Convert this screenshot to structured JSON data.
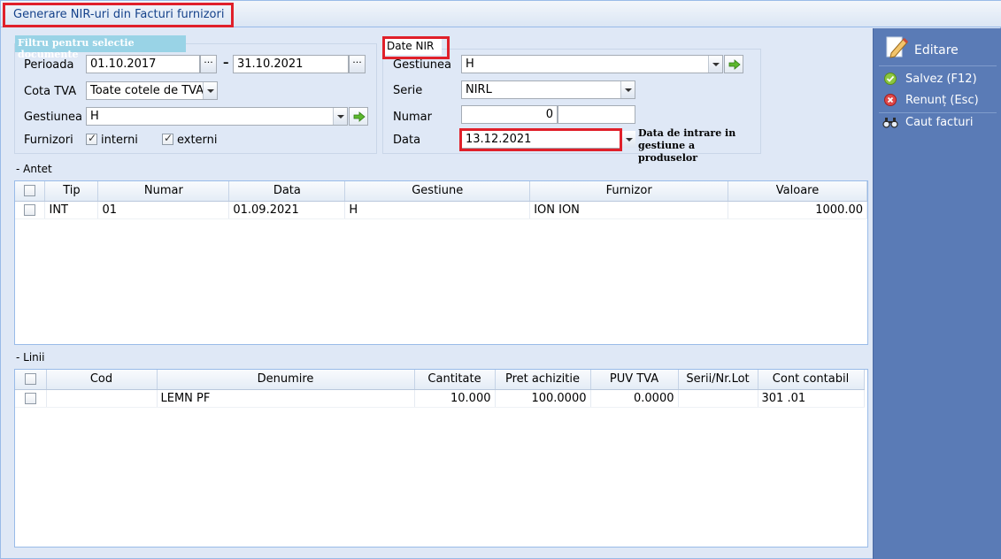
{
  "window": {
    "title": "Generare NIR-uri din Facturi furnizori"
  },
  "filter": {
    "legend": "Filtru pentru selectie documente",
    "perioada_label": "Perioada",
    "date_from": "01.10.2017",
    "date_to": "31.10.2021",
    "range_separator": "–",
    "dots_glyph": "···",
    "cota_tva_label": "Cota TVA",
    "cota_tva_value": "Toate cotele de TVA",
    "gestiunea_label": "Gestiunea",
    "gestiunea_value": "H",
    "furnizori_label": "Furnizori",
    "interni_label": "interni",
    "interni_checked": true,
    "externi_label": "externi",
    "externi_checked": true
  },
  "nir": {
    "legend": "Date NIR",
    "gestiunea_label": "Gestiunea",
    "gestiunea_value": "H",
    "serie_label": "Serie",
    "serie_value": "NIRL",
    "numar_label": "Numar",
    "numar_value": "0",
    "numar_value2": "",
    "data_label": "Data",
    "data_value": "13.12.2021",
    "annotation": "Data de intrare in gestiune a produselor"
  },
  "antet": {
    "section_label": "- Antet",
    "columns": [
      "Tip",
      "Numar",
      "Data",
      "Gestiune",
      "Furnizor",
      "Valoare"
    ],
    "rows": [
      {
        "tip": "INT",
        "numar": "01",
        "data": "01.09.2021",
        "gestiune": "H",
        "furnizor": "ION ION",
        "valoare": "1000.00"
      }
    ]
  },
  "linii": {
    "section_label": "- Linii",
    "columns": [
      "Cod",
      "Denumire",
      "Cantitate",
      "Pret achizitie",
      "PUV TVA",
      "Serii/Nr.Lot",
      "Cont contabil"
    ],
    "rows": [
      {
        "cod": "",
        "denumire": "LEMN PF",
        "cantitate": "10.000",
        "pret": "100.0000",
        "puv": "0.0000",
        "serii": "",
        "cont": "301 .01"
      }
    ]
  },
  "sidebar": {
    "editare": "Editare",
    "salvez": "Salvez (F12)",
    "renunt": "Renunț (Esc)",
    "caut": "Caut facturi"
  },
  "colors": {
    "highlight": "#e0202a",
    "sidebar": "#5a7bb6",
    "panel": "#dfe8f6"
  }
}
